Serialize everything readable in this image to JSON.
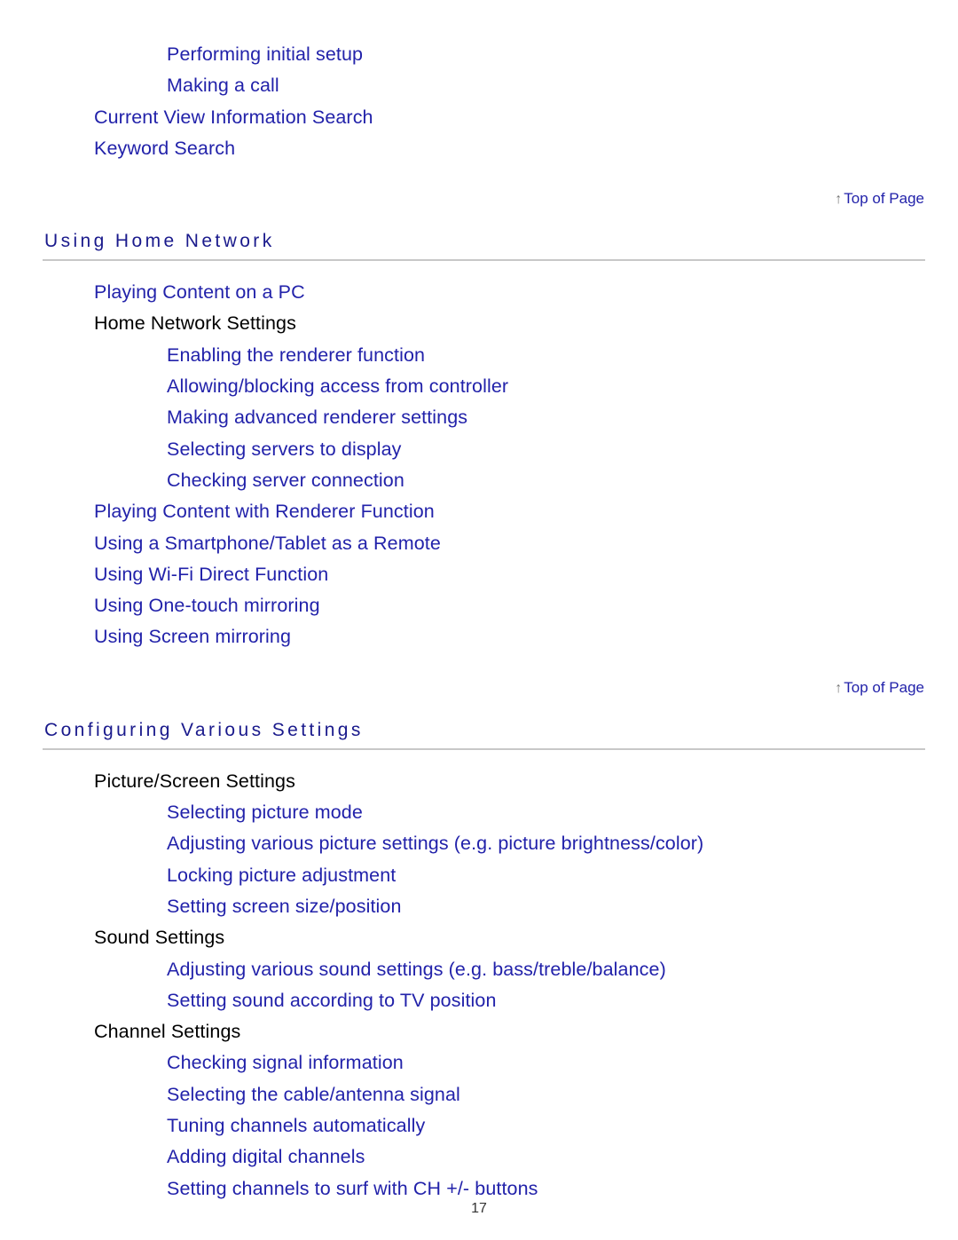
{
  "document": {
    "page_number": "17"
  },
  "intro_items": [
    {
      "label": "Performing initial setup",
      "level": 2,
      "link": true
    },
    {
      "label": "Making a call",
      "level": 2,
      "link": true
    },
    {
      "label": "Current View Information Search",
      "level": 1,
      "link": true
    },
    {
      "label": "Keyword Search",
      "level": 1,
      "link": true
    }
  ],
  "top_of_page": {
    "arrow": "↑",
    "label": "Top of Page",
    "icon": "up-arrow-icon"
  },
  "sections": [
    {
      "heading": "Using Home Network",
      "items": [
        {
          "label": "Playing Content on a PC",
          "level": 1,
          "link": true
        },
        {
          "label": "Home Network Settings",
          "level": 1,
          "link": false
        },
        {
          "label": "Enabling the renderer function",
          "level": 2,
          "link": true
        },
        {
          "label": "Allowing/blocking access from controller",
          "level": 2,
          "link": true
        },
        {
          "label": "Making advanced renderer settings",
          "level": 2,
          "link": true
        },
        {
          "label": "Selecting servers to display",
          "level": 2,
          "link": true
        },
        {
          "label": "Checking server connection",
          "level": 2,
          "link": true
        },
        {
          "label": "Playing Content with Renderer Function",
          "level": 1,
          "link": true
        },
        {
          "label": "Using a Smartphone/Tablet as a Remote",
          "level": 1,
          "link": true
        },
        {
          "label": "Using Wi-Fi Direct Function",
          "level": 1,
          "link": true
        },
        {
          "label": "Using One-touch mirroring",
          "level": 1,
          "link": true
        },
        {
          "label": "Using Screen mirroring",
          "level": 1,
          "link": true
        }
      ]
    },
    {
      "heading": "Configuring Various Settings",
      "items": [
        {
          "label": "Picture/Screen Settings",
          "level": 1,
          "link": false
        },
        {
          "label": "Selecting picture mode",
          "level": 2,
          "link": true
        },
        {
          "label": "Adjusting various picture settings (e.g. picture brightness/color)",
          "level": 2,
          "link": true
        },
        {
          "label": "Locking picture adjustment",
          "level": 2,
          "link": true
        },
        {
          "label": "Setting screen size/position",
          "level": 2,
          "link": true
        },
        {
          "label": "Sound Settings",
          "level": 1,
          "link": false
        },
        {
          "label": "Adjusting various sound settings (e.g. bass/treble/balance)",
          "level": 2,
          "link": true
        },
        {
          "label": "Setting sound according to TV position",
          "level": 2,
          "link": true
        },
        {
          "label": "Channel Settings",
          "level": 1,
          "link": false
        },
        {
          "label": "Checking signal information",
          "level": 2,
          "link": true
        },
        {
          "label": "Selecting the cable/antenna signal",
          "level": 2,
          "link": true
        },
        {
          "label": "Tuning channels automatically",
          "level": 2,
          "link": true
        },
        {
          "label": "Adding digital channels",
          "level": 2,
          "link": true
        },
        {
          "label": "Setting channels to surf with CH +/- buttons",
          "level": 2,
          "link": true
        }
      ]
    }
  ],
  "colors": {
    "link": "#2222aa",
    "heading": "#1a1a8c",
    "plain_text": "#000000",
    "rule": "#c8c8c8",
    "arrow": "#777777"
  }
}
